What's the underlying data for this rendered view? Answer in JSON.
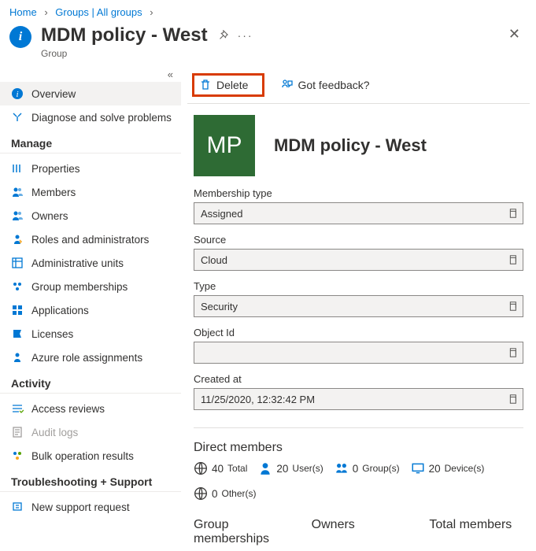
{
  "breadcrumbs": {
    "b1": "Home",
    "b2": "Groups | All groups"
  },
  "title": {
    "name": "MDM policy - West",
    "subtitle": "Group"
  },
  "sidebar": {
    "overview": "Overview",
    "diagnose": "Diagnose and solve problems",
    "manage_head": "Manage",
    "properties": "Properties",
    "members": "Members",
    "owners": "Owners",
    "roles": "Roles and administrators",
    "admin_units": "Administrative units",
    "group_memberships": "Group memberships",
    "applications": "Applications",
    "licenses": "Licenses",
    "azure_role": "Azure role assignments",
    "activity_head": "Activity",
    "access_reviews": "Access reviews",
    "audit_logs": "Audit logs",
    "bulk_results": "Bulk operation results",
    "ts_head": "Troubleshooting + Support",
    "support": "New support request"
  },
  "commands": {
    "delete": "Delete",
    "feedback": "Got feedback?"
  },
  "hero": {
    "initials": "MP",
    "name": "MDM policy - West"
  },
  "fields": {
    "membership_type_label": "Membership type",
    "membership_type_value": "Assigned",
    "source_label": "Source",
    "source_value": "Cloud",
    "type_label": "Type",
    "type_value": "Security",
    "objectid_label": "Object Id",
    "objectid_value": "",
    "created_label": "Created at",
    "created_value": "11/25/2020, 12:32:42 PM"
  },
  "direct_members": {
    "title": "Direct members",
    "total_n": "40",
    "total_l": "Total",
    "users_n": "20",
    "users_l": "User(s)",
    "groups_n": "0",
    "groups_l": "Group(s)",
    "devices_n": "20",
    "devices_l": "Device(s)",
    "others_n": "0",
    "others_l": "Other(s)"
  },
  "bottom": {
    "gm_title": "Group memberships",
    "owners_title": "Owners",
    "total_title": "Total members"
  }
}
